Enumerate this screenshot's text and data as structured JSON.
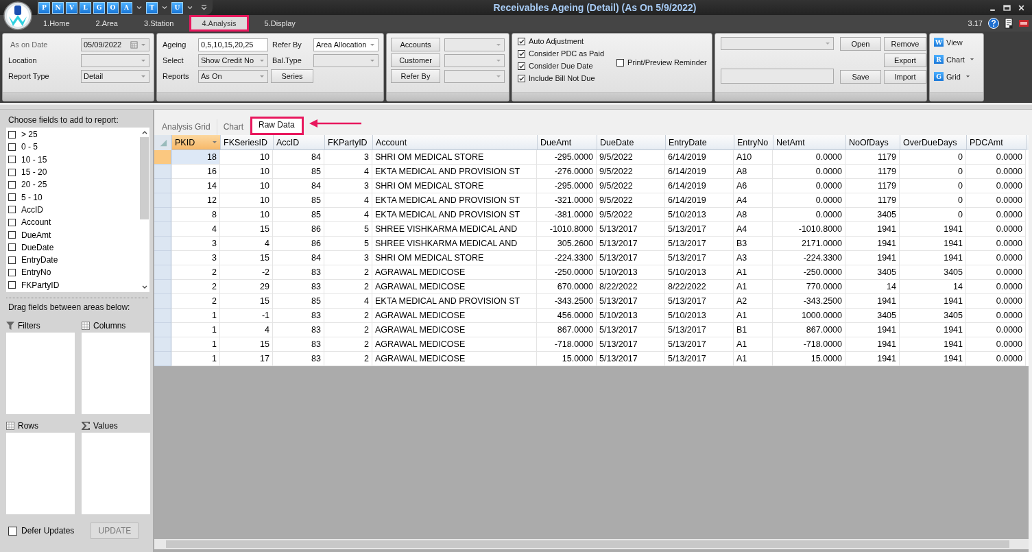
{
  "window": {
    "title": "Receivables Ageing (Detail) (As On 5/9/2022)",
    "version": "3.17"
  },
  "quick_access": [
    {
      "label": "P",
      "dropdown": false
    },
    {
      "label": "N",
      "dropdown": false
    },
    {
      "label": "V",
      "dropdown": false
    },
    {
      "label": "L",
      "dropdown": false
    },
    {
      "label": "G",
      "dropdown": false
    },
    {
      "label": "O",
      "dropdown": false
    },
    {
      "label": "A",
      "dropdown": true
    },
    {
      "label": "T",
      "dropdown": true
    },
    {
      "label": "U",
      "dropdown": true
    }
  ],
  "tabs": [
    {
      "label": "1.Home",
      "selected": false
    },
    {
      "label": "2.Area",
      "selected": false
    },
    {
      "label": "3.Station",
      "selected": false
    },
    {
      "label": "4.Analysis",
      "selected": true
    },
    {
      "label": "5.Display",
      "selected": false
    }
  ],
  "ribbon": {
    "date_group": [
      {
        "label": "As on Date",
        "value": "05/09/2022",
        "kind": "date",
        "dimmed": true
      },
      {
        "label": "Location",
        "kind": "combo",
        "dimmed": false
      },
      {
        "label": "Report Type",
        "value": "Detail",
        "kind": "combo",
        "dimmed": false
      }
    ],
    "ageing_group": {
      "left": [
        {
          "label": "Ageing",
          "value": "0,5,10,15,20,25",
          "kind": "text"
        },
        {
          "label": "Select",
          "value": "Show Credit No",
          "kind": "combo"
        },
        {
          "label": "Reports",
          "value": "As On",
          "kind": "combo"
        }
      ],
      "series_button": "Series",
      "right": [
        {
          "label": "Refer By",
          "value": "Area Allocation",
          "kind": "combo"
        },
        {
          "label": "Bal.Type",
          "kind": "combo"
        }
      ]
    },
    "account_group": [
      "Accounts",
      "Customer",
      "Refer By"
    ],
    "options": [
      {
        "label": "Auto Adjustment",
        "checked": true
      },
      {
        "label": "Consider PDC as Paid",
        "checked": true
      },
      {
        "label": "Consider Due Date",
        "checked": true
      },
      {
        "label": "Include Bill Not Due",
        "checked": true
      }
    ],
    "print_option": {
      "label": "Print/Preview Reminder",
      "checked": false
    },
    "layout_group": {
      "open": "Open",
      "remove": "Remove",
      "export": "Export",
      "save": "Save",
      "import": "Import"
    },
    "view_group": [
      {
        "label": "View",
        "icon": "W",
        "dropdown": false
      },
      {
        "label": "Chart",
        "icon": "R",
        "dropdown": true
      },
      {
        "label": "Grid",
        "icon": "G",
        "dropdown": true
      }
    ]
  },
  "field_list": {
    "title": "Choose fields to add to report:",
    "fields": [
      {
        "label": "> 25",
        "checked": false
      },
      {
        "label": "0 - 5",
        "checked": false
      },
      {
        "label": "10 - 15",
        "checked": false
      },
      {
        "label": "15 - 20",
        "checked": false
      },
      {
        "label": "20 - 25",
        "checked": false
      },
      {
        "label": "5 - 10",
        "checked": false
      },
      {
        "label": "AccID",
        "checked": false
      },
      {
        "label": "Account",
        "checked": false
      },
      {
        "label": "DueAmt",
        "checked": false
      },
      {
        "label": "DueDate",
        "checked": false
      },
      {
        "label": "EntryDate",
        "checked": false
      },
      {
        "label": "EntryNo",
        "checked": false
      },
      {
        "label": "FKPartyID",
        "checked": false
      }
    ]
  },
  "pivot_areas": {
    "hint": "Drag fields between areas below:",
    "areas": [
      {
        "label": "Filters",
        "kind": "filter"
      },
      {
        "label": "Columns",
        "kind": "columns"
      },
      {
        "label": "Rows",
        "kind": "rows"
      },
      {
        "label": "Values",
        "kind": "values"
      }
    ]
  },
  "defer_updates": {
    "label": "Defer Updates",
    "checked": false
  },
  "update_button": {
    "label": "UPDATE",
    "disabled": true
  },
  "view_tabs": [
    {
      "label": "Analysis Grid",
      "selected": false
    },
    {
      "label": "Chart",
      "selected": false
    },
    {
      "label": "Raw Data",
      "selected": true
    }
  ],
  "table": {
    "columns": [
      {
        "label": "PKID",
        "kind": "number",
        "sorted": true
      },
      {
        "label": "FKSeriesID",
        "kind": "number",
        "sorted": false
      },
      {
        "label": "AccID",
        "kind": "number",
        "sorted": false
      },
      {
        "label": "FKPartyID",
        "kind": "number",
        "sorted": false
      },
      {
        "label": "Account",
        "kind": "text",
        "sorted": false
      },
      {
        "label": "DueAmt",
        "kind": "number",
        "sorted": false
      },
      {
        "label": "DueDate",
        "kind": "text",
        "sorted": false
      },
      {
        "label": "EntryDate",
        "kind": "text",
        "sorted": false
      },
      {
        "label": "EntryNo",
        "kind": "text",
        "sorted": false
      },
      {
        "label": "NetAmt",
        "kind": "number",
        "sorted": false
      },
      {
        "label": "NoOfDays",
        "kind": "number",
        "sorted": false
      },
      {
        "label": "OverDueDays",
        "kind": "number",
        "sorted": false
      },
      {
        "label": "PDCAmt",
        "kind": "number",
        "sorted": false
      }
    ],
    "rows": [
      {
        "selected": true,
        "cells": [
          "18",
          "10",
          "84",
          "3",
          "SHRI OM MEDICAL STORE",
          "-295.0000",
          "9/5/2022",
          "6/14/2019",
          "A10",
          "0.0000",
          "1179",
          "0",
          "0.0000"
        ]
      },
      {
        "selected": false,
        "cells": [
          "16",
          "10",
          "85",
          "4",
          "EKTA MEDICAL AND PROVISION ST",
          "-276.0000",
          "9/5/2022",
          "6/14/2019",
          "A8",
          "0.0000",
          "1179",
          "0",
          "0.0000"
        ]
      },
      {
        "selected": false,
        "cells": [
          "14",
          "10",
          "84",
          "3",
          "SHRI OM MEDICAL STORE",
          "-295.0000",
          "9/5/2022",
          "6/14/2019",
          "A6",
          "0.0000",
          "1179",
          "0",
          "0.0000"
        ]
      },
      {
        "selected": false,
        "cells": [
          "12",
          "10",
          "85",
          "4",
          "EKTA MEDICAL AND PROVISION ST",
          "-321.0000",
          "9/5/2022",
          "6/14/2019",
          "A4",
          "0.0000",
          "1179",
          "0",
          "0.0000"
        ]
      },
      {
        "selected": false,
        "cells": [
          "8",
          "10",
          "85",
          "4",
          "EKTA MEDICAL AND PROVISION ST",
          "-381.0000",
          "9/5/2022",
          "5/10/2013",
          "A8",
          "0.0000",
          "3405",
          "0",
          "0.0000"
        ]
      },
      {
        "selected": false,
        "cells": [
          "4",
          "15",
          "86",
          "5",
          "SHREE VISHKARMA MEDICAL AND",
          "-1010.8000",
          "5/13/2017",
          "5/13/2017",
          "A4",
          "-1010.8000",
          "1941",
          "1941",
          "0.0000"
        ]
      },
      {
        "selected": false,
        "cells": [
          "3",
          "4",
          "86",
          "5",
          "SHREE VISHKARMA MEDICAL AND",
          "305.2600",
          "5/13/2017",
          "5/13/2017",
          "B3",
          "2171.0000",
          "1941",
          "1941",
          "0.0000"
        ]
      },
      {
        "selected": false,
        "cells": [
          "3",
          "15",
          "84",
          "3",
          "SHRI OM MEDICAL STORE",
          "-224.3300",
          "5/13/2017",
          "5/13/2017",
          "A3",
          "-224.3300",
          "1941",
          "1941",
          "0.0000"
        ]
      },
      {
        "selected": false,
        "cells": [
          "2",
          "-2",
          "83",
          "2",
          "AGRAWAL MEDICOSE",
          "-250.0000",
          "5/10/2013",
          "5/10/2013",
          "A1",
          "-250.0000",
          "3405",
          "3405",
          "0.0000"
        ]
      },
      {
        "selected": false,
        "cells": [
          "2",
          "29",
          "83",
          "2",
          "AGRAWAL MEDICOSE",
          "670.0000",
          "8/22/2022",
          "8/22/2022",
          "A1",
          "770.0000",
          "14",
          "14",
          "0.0000"
        ]
      },
      {
        "selected": false,
        "cells": [
          "2",
          "15",
          "85",
          "4",
          "EKTA MEDICAL AND PROVISION ST",
          "-343.2500",
          "5/13/2017",
          "5/13/2017",
          "A2",
          "-343.2500",
          "1941",
          "1941",
          "0.0000"
        ]
      },
      {
        "selected": false,
        "cells": [
          "1",
          "-1",
          "83",
          "2",
          "AGRAWAL MEDICOSE",
          "456.0000",
          "5/10/2013",
          "5/10/2013",
          "A1",
          "1000.0000",
          "3405",
          "3405",
          "0.0000"
        ]
      },
      {
        "selected": false,
        "cells": [
          "1",
          "4",
          "83",
          "2",
          "AGRAWAL MEDICOSE",
          "867.0000",
          "5/13/2017",
          "5/13/2017",
          "B1",
          "867.0000",
          "1941",
          "1941",
          "0.0000"
        ]
      },
      {
        "selected": false,
        "cells": [
          "1",
          "15",
          "83",
          "2",
          "AGRAWAL MEDICOSE",
          "-718.0000",
          "5/13/2017",
          "5/13/2017",
          "A1",
          "-718.0000",
          "1941",
          "1941",
          "0.0000"
        ]
      },
      {
        "selected": false,
        "cells": [
          "1",
          "17",
          "83",
          "2",
          "AGRAWAL MEDICOSE",
          "15.0000",
          "5/13/2017",
          "5/13/2017",
          "A1",
          "15.0000",
          "1941",
          "1941",
          "0.0000"
        ]
      }
    ]
  }
}
